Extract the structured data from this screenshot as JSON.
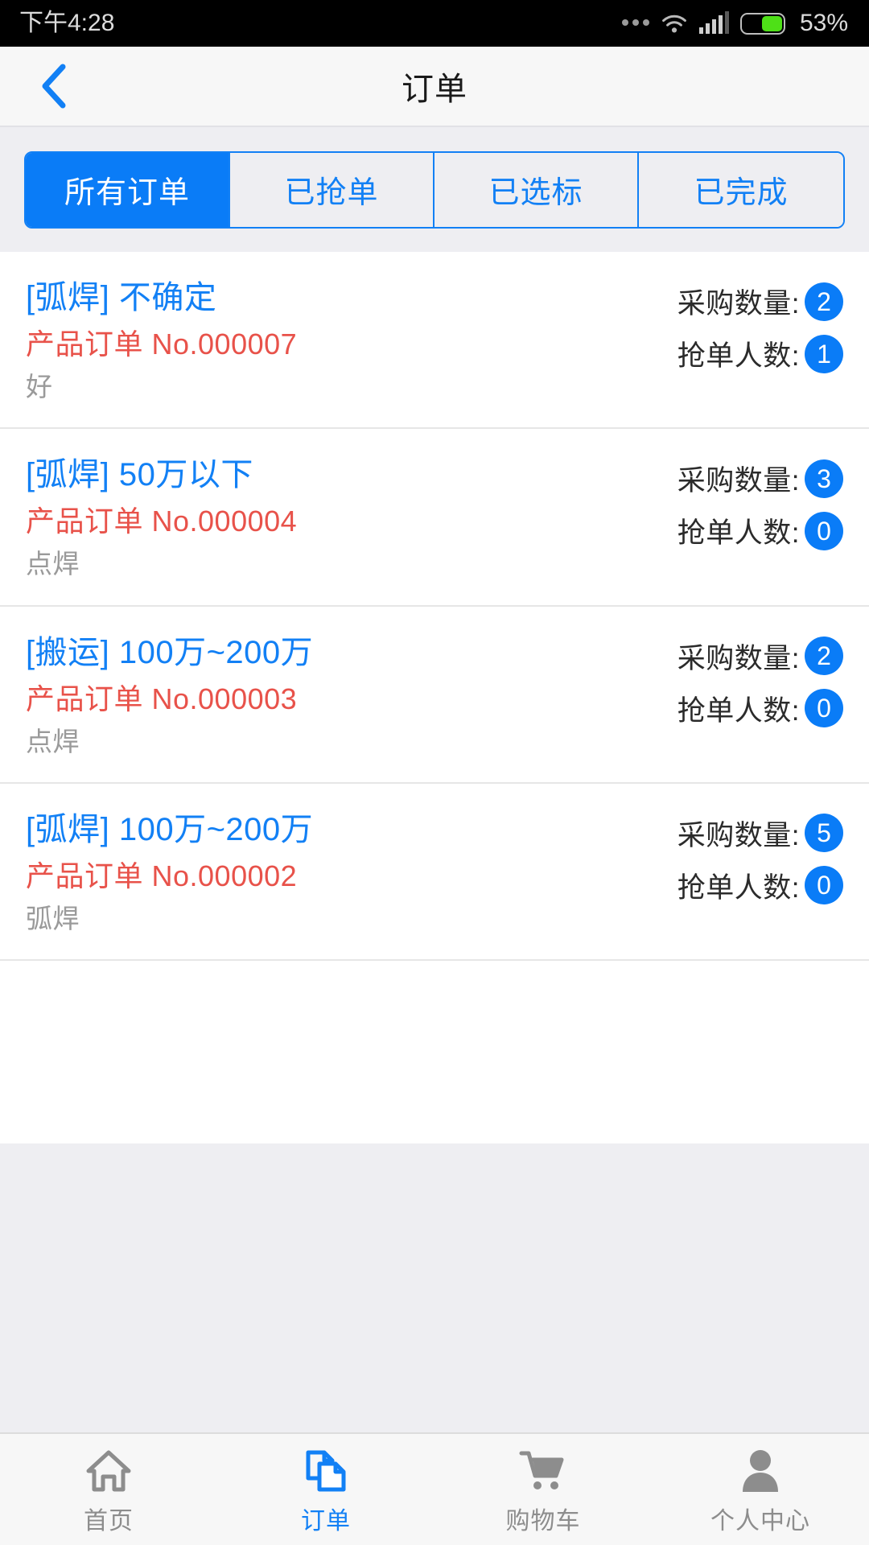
{
  "status_bar": {
    "time": "下午4:28",
    "battery_percent_label": "53%",
    "battery_level": 53,
    "icons": [
      "more-dots-icon",
      "wifi-icon",
      "cellular-signal-icon",
      "battery-icon"
    ]
  },
  "header": {
    "title": "订单",
    "back_icon": "chevron-left-icon"
  },
  "filter_tabs": {
    "active_index": 0,
    "items": [
      {
        "label": "所有订单"
      },
      {
        "label": "已抢单"
      },
      {
        "label": "已选标"
      },
      {
        "label": "已完成"
      }
    ]
  },
  "labels": {
    "quantity": "采购数量:",
    "grabbers": "抢单人数:"
  },
  "orders": [
    {
      "title": "[弧焊] 不确定",
      "order_no": "产品订单 No.000007",
      "description": "好",
      "quantity": "2",
      "grabbers": "1"
    },
    {
      "title": "[弧焊] 50万以下",
      "order_no": "产品订单 No.000004",
      "description": "点焊",
      "quantity": "3",
      "grabbers": "0"
    },
    {
      "title": "[搬运] 100万~200万",
      "order_no": "产品订单 No.000003",
      "description": "点焊",
      "quantity": "2",
      "grabbers": "0"
    },
    {
      "title": "[弧焊] 100万~200万",
      "order_no": "产品订单 No.000002",
      "description": "弧焊",
      "quantity": "5",
      "grabbers": "0"
    }
  ],
  "bottom_nav": {
    "active_index": 1,
    "items": [
      {
        "label": "首页",
        "icon": "home-icon"
      },
      {
        "label": "订单",
        "icon": "documents-icon"
      },
      {
        "label": "购物车",
        "icon": "shopping-cart-icon"
      },
      {
        "label": "个人中心",
        "icon": "person-icon"
      }
    ]
  },
  "colors": {
    "accent_blue": "#0a7cf7",
    "title_blue": "#1280f5",
    "order_red": "#e8524a",
    "desc_grey": "#9a9a9a",
    "page_bg": "#eeeef2",
    "battery_green": "#4ee017"
  }
}
